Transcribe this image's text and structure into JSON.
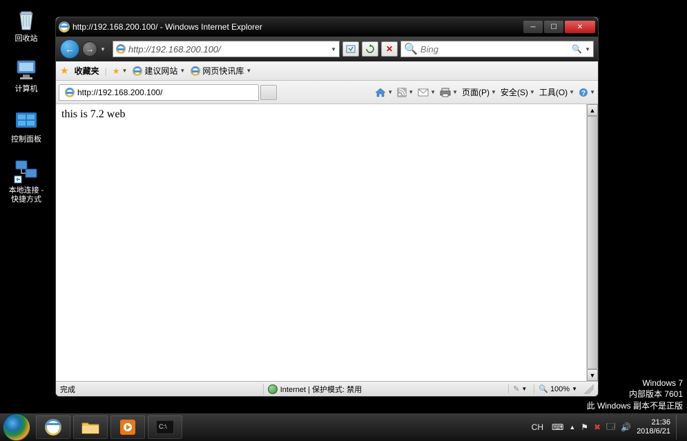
{
  "desktop_icons": {
    "recycle": "回收站",
    "computer": "计算机",
    "control_panel": "控制面板",
    "network": "本地连接 - 快捷方式"
  },
  "window": {
    "title": "http://192.168.200.100/ - Windows Internet Explorer"
  },
  "nav": {
    "url": "http://192.168.200.100/",
    "search_placeholder": "Bing"
  },
  "favbar": {
    "label": "收藏夹",
    "suggest": "建议网站",
    "slice": "网页快讯库"
  },
  "tab": {
    "title": "http://192.168.200.100/"
  },
  "tools": {
    "page": "页面(P)",
    "safety": "安全(S)",
    "tools_m": "工具(O)"
  },
  "page_content": "this is 7.2 web",
  "status": {
    "done": "完成",
    "zone": "Internet | 保护模式: 禁用",
    "zoom": "100%"
  },
  "watermark": {
    "os": "Windows 7",
    "build": "内部版本 7601",
    "genuine": "此 Windows 副本不是正版"
  },
  "tray": {
    "lang": "CH",
    "time": "21:36",
    "date": "2018/6/21"
  }
}
